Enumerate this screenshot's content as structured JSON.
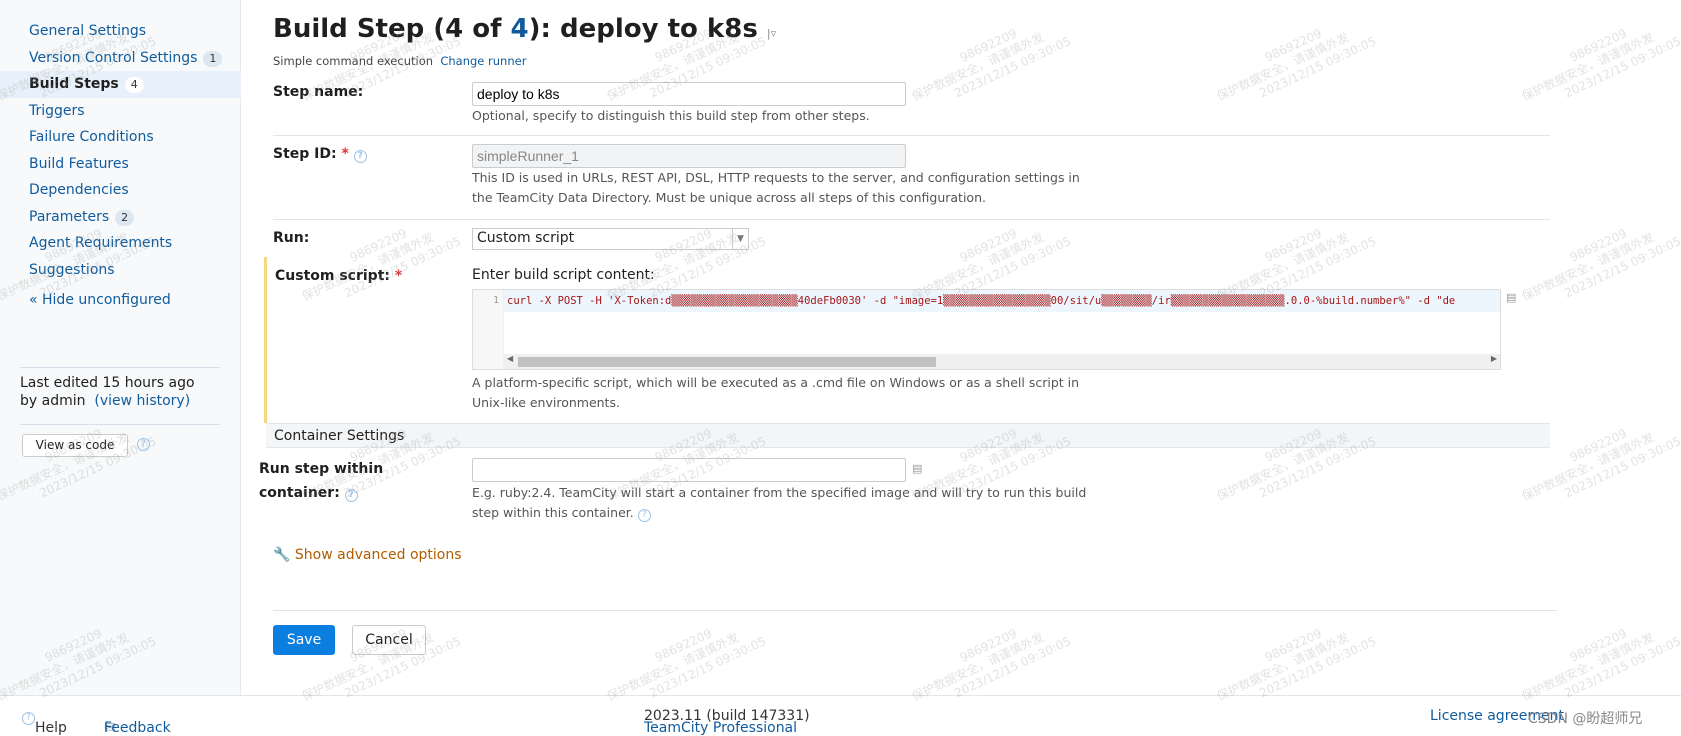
{
  "sidebar": {
    "items": [
      {
        "label": "General Settings",
        "badge": ""
      },
      {
        "label": "Version Control Settings",
        "badge": "1"
      },
      {
        "label": "Build Steps",
        "badge": "4",
        "active": true
      },
      {
        "label": "Triggers",
        "badge": ""
      },
      {
        "label": "Failure Conditions",
        "badge": ""
      },
      {
        "label": "Build Features",
        "badge": ""
      },
      {
        "label": "Dependencies",
        "badge": ""
      },
      {
        "label": "Parameters",
        "badge": "2"
      },
      {
        "label": "Agent Requirements",
        "badge": ""
      },
      {
        "label": "Suggestions",
        "badge": ""
      }
    ],
    "hide_unconfigured": "« Hide unconfigured",
    "last_edited": "Last edited 15 hours ago",
    "by": "by admin",
    "view_history": "(view history)",
    "view_as_code": "View as code"
  },
  "header": {
    "title_prefix": "Build Step (4 of ",
    "title_num": "4",
    "title_suffix": "): deploy to k8s",
    "runner": "Simple command execution",
    "change_runner": "Change runner"
  },
  "form": {
    "step_name": {
      "label": "Step name:",
      "value": "deploy to k8s",
      "note": "Optional, specify to distinguish this build step from other steps."
    },
    "step_id": {
      "label": "Step ID:",
      "value": "simpleRunner_1",
      "note": "This ID is used in URLs, REST API, DSL, HTTP requests to the server, and configuration settings in the TeamCity Data Directory. Must be unique across all steps of this configuration."
    },
    "run": {
      "label": "Run:",
      "value": "Custom script"
    },
    "custom_script": {
      "label": "Custom script:",
      "prompt": "Enter build script content:",
      "line_number": "1",
      "code": "curl -X POST -H 'X-Token:d▒▒▒▒▒▒▒▒▒▒▒▒▒▒▒▒▒▒▒▒40deFb0030' -d \"image=1▒▒▒▒▒▒▒▒▒▒▒▒▒▒▒▒▒00/sit/u▒▒▒▒▒▒▒▒/ir▒▒▒▒▒▒▒▒▒▒▒▒▒▒▒▒▒▒.0.0-%build.number%\" -d \"de",
      "note": "A platform-specific script, which will be executed as a .cmd file on Windows or as a shell script in Unix-like environments."
    },
    "container_section": "Container Settings",
    "container": {
      "label_line1": "Run step within",
      "label_line2": "container:",
      "value": "",
      "note": "E.g. ruby:2.4. TeamCity will start a container from the specified image and will try to run this build step within this container."
    },
    "advanced": "Show advanced options",
    "save": "Save",
    "cancel": "Cancel"
  },
  "footer": {
    "help": "Help",
    "feedback": "Feedback",
    "product": "TeamCity Professional",
    "version": "2023.11 (build 147331)",
    "license": "License agreement",
    "credit": "CSDN @盼超师兄"
  },
  "watermark": {
    "line1": "98692209",
    "line2": "保护数据安全，请谨慎外发",
    "line3": "2023/12/15 09:30:05"
  }
}
